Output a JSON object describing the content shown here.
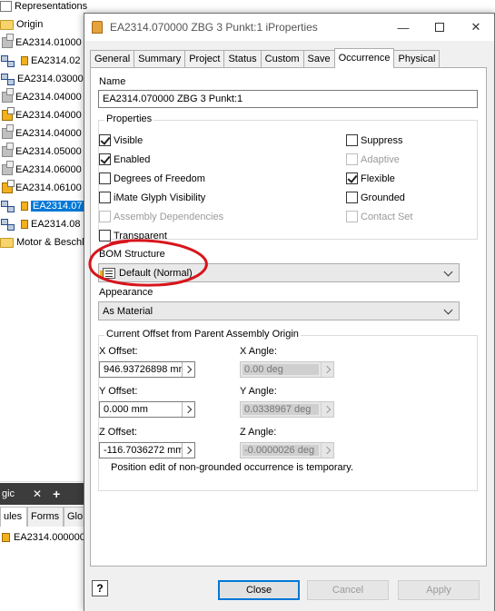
{
  "browser": {
    "rows": [
      {
        "label": "Representations",
        "icon": "rep"
      },
      {
        "label": "Origin",
        "icon": "folder"
      },
      {
        "label": "EA2314.01000",
        "icon": "grey"
      },
      {
        "label": "EA2314.02",
        "icon": "asm-lock"
      },
      {
        "label": "EA2314.03000",
        "icon": "asm"
      },
      {
        "label": "EA2314.04000",
        "icon": "grey"
      },
      {
        "label": "EA2314.04000",
        "icon": "part"
      },
      {
        "label": "EA2314.04000",
        "icon": "grey"
      },
      {
        "label": "EA2314.05000",
        "icon": "grey"
      },
      {
        "label": "EA2314.06000",
        "icon": "grey"
      },
      {
        "label": "EA2314.06100",
        "icon": "part"
      },
      {
        "label": "EA2314.07",
        "icon": "asm-lock"
      },
      {
        "label": "EA2314.08",
        "icon": "asm"
      },
      {
        "label": "Motor & Beschl",
        "icon": "folder"
      }
    ]
  },
  "bottom_panel": {
    "tab_label": "gic",
    "close_glyph": "✕",
    "add_glyph": "+",
    "tabs": [
      "ules",
      "Forms",
      "Glo"
    ],
    "item": "EA2314.000000"
  },
  "dialog": {
    "title": "EA2314.070000  ZBG 3 Punkt:1 iProperties",
    "minimize_glyph": "—",
    "close_glyph": "✕",
    "tabs": [
      "General",
      "Summary",
      "Project",
      "Status",
      "Custom",
      "Save",
      "Occurrence",
      "Physical"
    ],
    "name_label": "Name",
    "name_value": "EA2314.070000  ZBG 3 Punkt:1",
    "properties_label": "Properties",
    "props": {
      "visible": "Visible",
      "enabled": "Enabled",
      "dof": "Degrees of Freedom",
      "imate": "iMate Glyph Visibility",
      "asm_dep": "Assembly Dependencies",
      "transparent": "Transparent",
      "suppress": "Suppress",
      "adaptive": "Adaptive",
      "flexible": "Flexible",
      "grounded": "Grounded",
      "contact_set": "Contact Set"
    },
    "bom_label": "BOM Structure",
    "bom_value": "Default (Normal)",
    "appearance_label": "Appearance",
    "appearance_value": "As Material",
    "offset_group_label": "Current Offset from Parent Assembly Origin",
    "x_offset_label": "X Offset:",
    "x_offset_value": "946.93726898 mm",
    "y_offset_label": "Y Offset:",
    "y_offset_value": "0.000 mm",
    "z_offset_label": "Z Offset:",
    "z_offset_value": "-116.7036272 mm",
    "x_angle_label": "X Angle:",
    "x_angle_value": "0.00 deg",
    "y_angle_label": "Y Angle:",
    "y_angle_value": "0.0338967 deg",
    "z_angle_label": "Z Angle:",
    "z_angle_value": "-0.0000026 deg",
    "note": "Position edit of non-grounded occurrence is temporary.",
    "help_glyph": "?",
    "close_button": "Close",
    "cancel_button": "Cancel",
    "apply_button": "Apply"
  },
  "colors": {
    "selection": "#0078d7",
    "annotation": "#d7151d",
    "dialog_bg": "#f0f0f0"
  }
}
